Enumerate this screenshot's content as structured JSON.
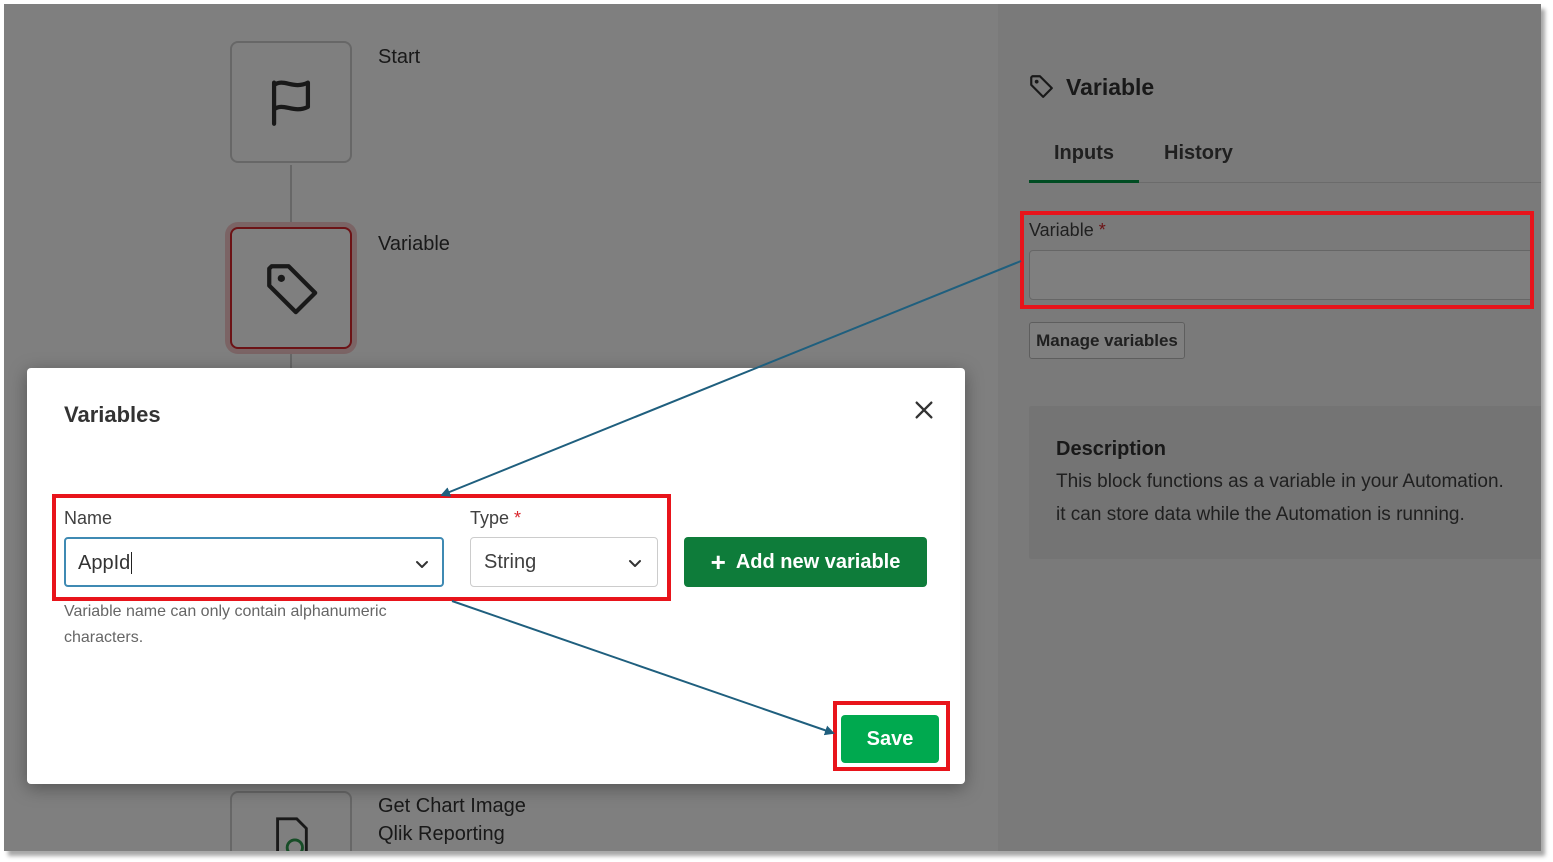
{
  "canvas": {
    "blocks": [
      {
        "label": "Start",
        "icon": "flag-icon"
      },
      {
        "label": "Variable",
        "icon": "tag-icon"
      },
      {
        "label": "Get Chart Image",
        "sublabel": "Qlik Reporting",
        "icon": "chart-document-icon"
      }
    ]
  },
  "panel": {
    "title": "Variable",
    "title_icon": "tag-icon",
    "tabs": [
      {
        "label": "Inputs",
        "active": true
      },
      {
        "label": "History",
        "active": false
      }
    ],
    "variable_field": {
      "label": "Variable",
      "required_mark": "*",
      "value": ""
    },
    "manage_variables_label": "Manage variables",
    "description": {
      "title": "Description",
      "lines": [
        "This block functions as a variable in your Automation.",
        "it can store data while the Automation is running."
      ]
    }
  },
  "modal": {
    "title": "Variables",
    "close_icon": "close-icon",
    "name_field": {
      "label": "Name",
      "value": "AppId"
    },
    "type_field": {
      "label": "Type",
      "required_mark": "*",
      "value": "String"
    },
    "add_button_label": "Add new variable",
    "hint_lines": [
      "Variable name can only contain alphanumeric",
      "characters."
    ],
    "save_label": "Save"
  },
  "colors": {
    "accent_green": "#009845",
    "add_button_green": "#0e7c3a",
    "save_button_green": "#00a94f",
    "annotation_red": "#e8141b",
    "annotation_arrow": "#1f5f7e",
    "focus_blue": "#3f8ab3"
  }
}
